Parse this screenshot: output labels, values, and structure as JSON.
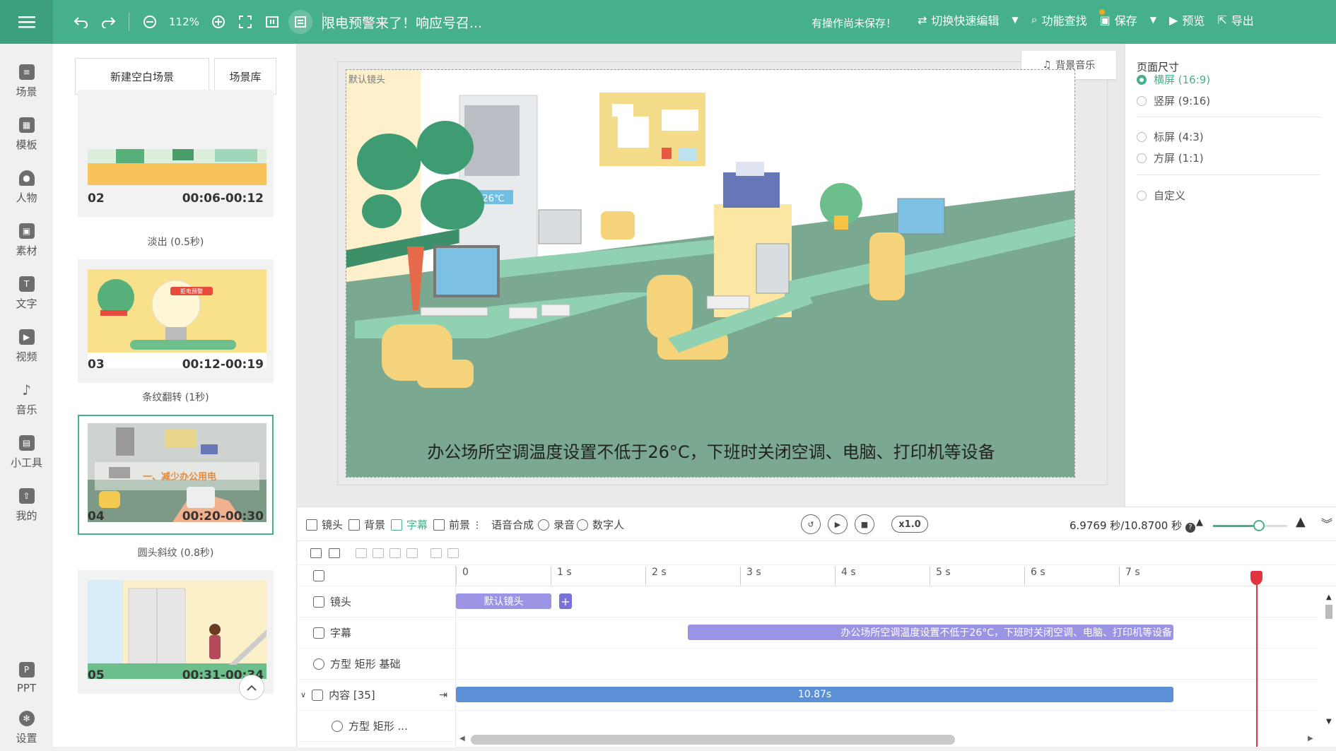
{
  "topbar": {
    "zoom": "112%",
    "title": "限电预警来了！响应号召...",
    "unsaved": "有操作尚未保存！",
    "switch_edit": "切换快速编辑",
    "feature_search": "功能查找",
    "save": "保存",
    "preview": "预览",
    "export": "导出"
  },
  "left_nav": {
    "items": [
      {
        "label": "场景",
        "icon": "scene-icon"
      },
      {
        "label": "模板",
        "icon": "template-icon"
      },
      {
        "label": "人物",
        "icon": "person-icon"
      },
      {
        "label": "素材",
        "icon": "material-icon"
      },
      {
        "label": "文字",
        "icon": "text-icon"
      },
      {
        "label": "视频",
        "icon": "video-icon"
      },
      {
        "label": "音乐",
        "icon": "music-icon"
      },
      {
        "label": "小工具",
        "icon": "toolbox-icon"
      },
      {
        "label": "我的",
        "icon": "mine-icon"
      }
    ],
    "bottom": [
      {
        "label": "PPT",
        "icon": "ppt-icon"
      },
      {
        "label": "设置",
        "icon": "settings-icon"
      }
    ]
  },
  "scene_panel": {
    "new_blank": "新建空白场景",
    "library": "场景库",
    "scenes": [
      {
        "num": "02",
        "time": "00:06-00:12"
      },
      {
        "num": "03",
        "time": "00:12-00:19"
      },
      {
        "num": "04",
        "time": "00:20-00:30"
      },
      {
        "num": "05",
        "time": "00:31-00:34"
      }
    ],
    "transitions": [
      "淡出 (0.5秒)",
      "条纹翻转 (1秒)",
      "圆头斜纹 (0.8秒)"
    ],
    "thumb_badge_03": "拒电预警",
    "thumb_banner_04": "一、减少办公用电"
  },
  "stage": {
    "camera_label": "默认镜头",
    "bgm": "背景音乐",
    "subtitle": "办公场所空调温度设置不低于26°C，下班时关闭空调、电脑、打印机等设备",
    "ac_display": "26℃"
  },
  "properties": {
    "heading": "页面尺寸",
    "options": [
      "横屏 (16:9)",
      "竖屏 (9:16)",
      "标屏 (4:3)",
      "方屏 (1:1)",
      "自定义"
    ],
    "selected": "横屏 (16:9)"
  },
  "timeline": {
    "tabs": [
      "镜头",
      "背景",
      "字幕",
      "前景",
      "语音合成",
      "录音",
      "数字人"
    ],
    "active_tab": "字幕",
    "speed": "x1.0",
    "timecode": "6.9769 秒/10.8700 秒",
    "zoom_level": 0.62,
    "ruler": [
      "0",
      "1 s",
      "2 s",
      "3 s",
      "4 s",
      "5 s",
      "6 s",
      "7 s"
    ],
    "tracks": [
      "镜头",
      "字幕",
      "方型 矩形 基础",
      "内容 [35]",
      "方型 矩形 ..."
    ],
    "clips": {
      "camera": "默认镜头",
      "subtitle": "办公场所空调温度设置不低于26°C，下班时关闭空调、电脑、打印机等设备",
      "content": "10.87s"
    }
  },
  "colors": {
    "accent": "#46b08a",
    "clip_purple": "#9b93e3",
    "clip_blue": "#5b8fd6",
    "playhead": "#e0343f"
  }
}
